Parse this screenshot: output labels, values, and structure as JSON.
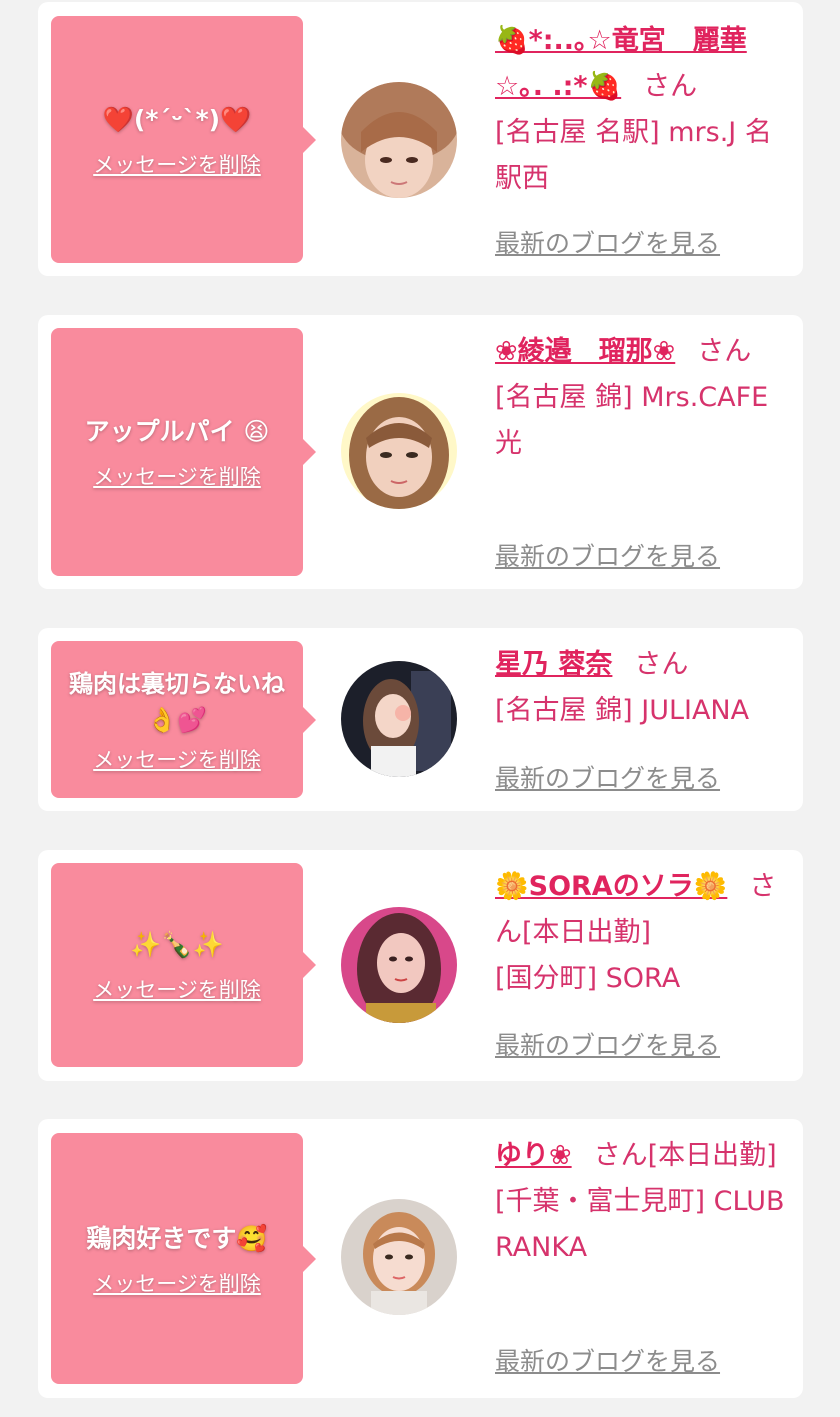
{
  "delete_label": "メッセージを削除",
  "blog_label": "最新のブログを見る",
  "items": [
    {
      "message": "❤️(*´ᵕ`*)❤️",
      "name": "🍓*:..｡☆竜宮　麗華☆｡. .:*🍓",
      "honorific": "さん",
      "location": "[名古屋 名駅] mrs.J 名駅西"
    },
    {
      "message": "アップルパイ 😫",
      "name": "❀綾邉　瑠那❀",
      "honorific": "さん",
      "location": "[名古屋 錦] Mrs.CAFE 光"
    },
    {
      "message": "鶏肉は裏切らないね 👌💕",
      "name": "星乃 蓉奈",
      "honorific": "さん",
      "location": "[名古屋 錦] JULIANA"
    },
    {
      "message": "✨🍾✨",
      "name": "🌼SORAのソラ🌼",
      "honorific": "さん[本日出勤]",
      "location": "[国分町] SORA"
    },
    {
      "message": "鶏肉好きです🥰",
      "name": "ゆり❀",
      "honorific": "さん[本日出勤]",
      "location": "[千葉・富士見町] CLUB RANKA"
    }
  ],
  "colors": {
    "page_background": "#f2f2f2",
    "bubble": "#f98b9d",
    "name_text": "#e0245e",
    "location_text": "#d6336c",
    "blog_link": "#8c8c8c"
  }
}
